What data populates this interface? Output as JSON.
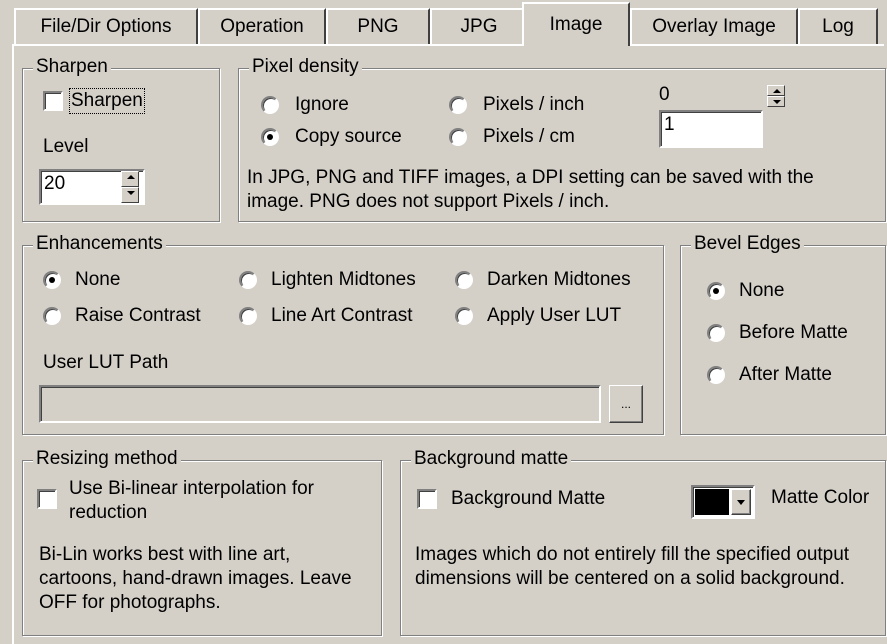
{
  "tabs": [
    {
      "label": "File/Dir Options"
    },
    {
      "label": "Operation"
    },
    {
      "label": "PNG"
    },
    {
      "label": "JPG"
    },
    {
      "label": "Image"
    },
    {
      "label": "Overlay Image"
    },
    {
      "label": "Log"
    }
  ],
  "active_tab": "Image",
  "sharpen": {
    "title": "Sharpen",
    "checkbox_label": "Sharpen",
    "checked": false,
    "level_label": "Level",
    "level_value": "20"
  },
  "pixel_density": {
    "title": "Pixel density",
    "options": [
      "Ignore",
      "Copy source",
      "Pixels / inch",
      "Pixels / cm"
    ],
    "selected": "Copy source",
    "spin_value": "0",
    "field_value": "1",
    "note": "In JPG, PNG and TIFF images, a DPI setting can be saved with the image. PNG does not support Pixels / inch."
  },
  "enhancements": {
    "title": "Enhancements",
    "options": [
      "None",
      "Lighten Midtones",
      "Darken Midtones",
      "Raise Contrast",
      "Line Art Contrast",
      "Apply User LUT"
    ],
    "selected": "None",
    "lut_label": "User LUT Path",
    "lut_value": "",
    "browse_label": "..."
  },
  "bevel": {
    "title": "Bevel Edges",
    "options": [
      "None",
      "Before Matte",
      "After Matte"
    ],
    "selected": "None"
  },
  "resizing": {
    "title": "Resizing method",
    "checkbox_label": "Use Bi-linear interpolation for reduction",
    "checked": false,
    "note": "Bi-Lin works best with line art, cartoons, hand-drawn images. Leave OFF for photographs."
  },
  "matte": {
    "title": "Background matte",
    "checkbox_label": "Background Matte",
    "checked": false,
    "color_label": "Matte Color",
    "color_value": "#000000",
    "note": "Images which do not entirely fill the specified output dimensions will be centered on a solid background."
  }
}
